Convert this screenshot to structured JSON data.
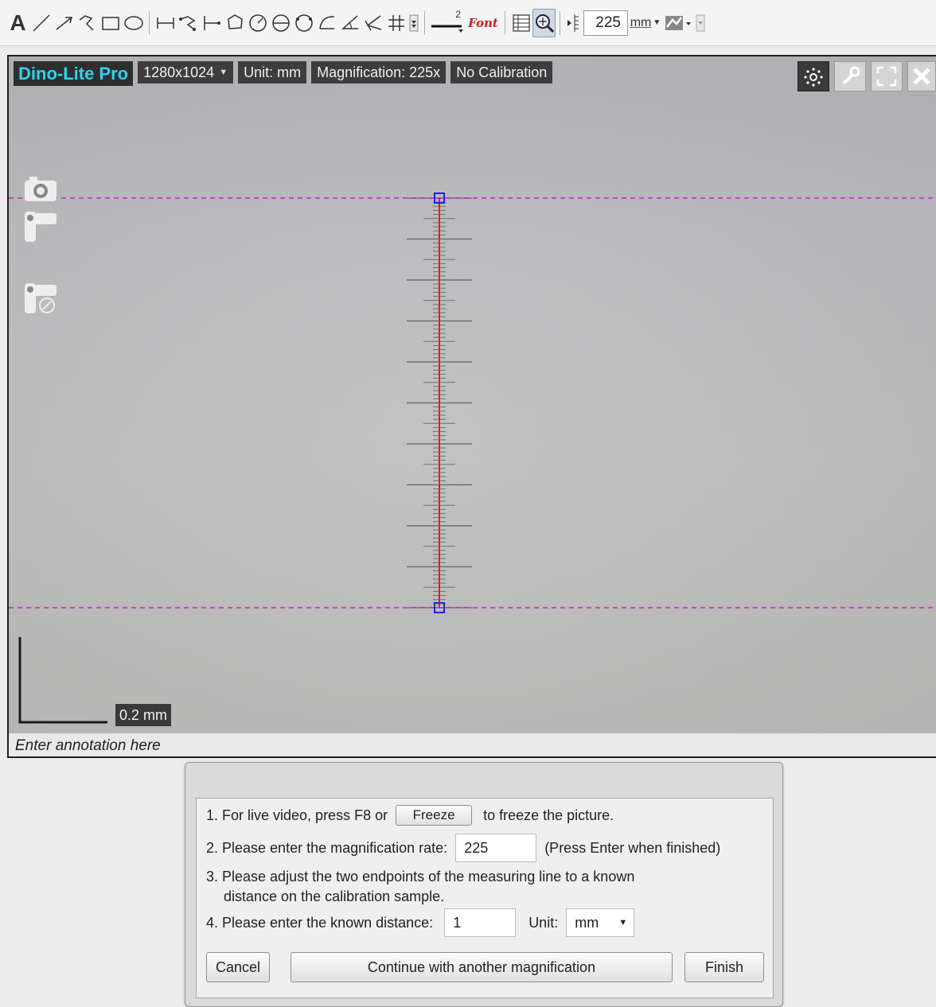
{
  "toolbar": {
    "text_tool": "A",
    "font_button": "Font",
    "line_width_label": "2",
    "zoom_value": "225",
    "unit_dropdown": "mm"
  },
  "viewer": {
    "brand": "Dino-Lite Pro",
    "resolution": "1280x1024",
    "unit": "Unit: mm",
    "magnification": "Magnification: 225x",
    "calibration": "No Calibration",
    "scale_bar_label": "0.2 mm",
    "annotation_placeholder": "Enter annotation here"
  },
  "dialog": {
    "step1_prefix": "1. For live video, press F8 or",
    "freeze_button": "Freeze",
    "step1_suffix": "to freeze the picture.",
    "step2_label": "2. Please enter the magnification rate:",
    "magnification_value": "225",
    "step2_hint": "(Press Enter when finished)",
    "step3_line1": "3. Please adjust the two endpoints of the measuring line to a known",
    "step3_line2": "distance on the calibration sample.",
    "step4_label": "4. Please enter the known distance:",
    "distance_value": "1",
    "unit_label": "Unit:",
    "unit_value": "mm",
    "cancel_button": "Cancel",
    "continue_button": "Continue with another magnification",
    "finish_button": "Finish"
  },
  "colors": {
    "brand_text": "#2fd3ee",
    "measure_line": "#e02020",
    "guide_line": "#d020d0",
    "endpoint_handle": "#1a2ad0"
  }
}
